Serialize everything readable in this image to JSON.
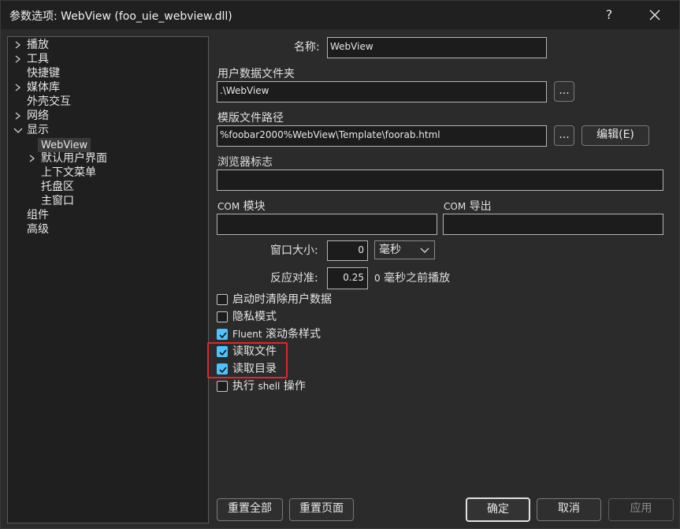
{
  "window": {
    "title": "参数选项: WebView (foo_uie_webview.dll)",
    "help": "?"
  },
  "tree": {
    "items": [
      {
        "label": "播放",
        "chevron": "right"
      },
      {
        "label": "工具",
        "chevron": "right"
      },
      {
        "label": "快捷键"
      },
      {
        "label": "媒体库",
        "chevron": "right"
      },
      {
        "label": "外壳交互"
      },
      {
        "label": "网络",
        "chevron": "right"
      },
      {
        "label": "显示",
        "chevron": "down"
      },
      {
        "label": "WebView",
        "selected": true
      },
      {
        "label": "默认用户界面",
        "chevron": "right"
      },
      {
        "label": "上下文菜单"
      },
      {
        "label": "托盘区"
      },
      {
        "label": "主窗口"
      },
      {
        "label": "组件"
      },
      {
        "label": "高级"
      }
    ]
  },
  "form": {
    "name_label": "名称:",
    "name_value": "WebView",
    "user_data_label": "用户数据文件夹",
    "user_data_value": ".\\WebView",
    "browse1": "...",
    "template_label": "模版文件路径",
    "template_value": "%foobar2000%WebView\\Template\\foorab.html",
    "browse2": "...",
    "edit_button": "编辑(E)",
    "browser_flags_label": "浏览器标志",
    "browser_flags_value": "",
    "com_module_label_prefix": "COM",
    "com_module_label": "模块",
    "com_module_value": "",
    "com_export_label_prefix": "COM",
    "com_export_label": "导出",
    "com_export_value": "",
    "window_size_label": "窗口大小:",
    "window_size_value": "0",
    "window_size_unit": "毫秒",
    "reaction_label": "反应对准:",
    "reaction_value": "0.25",
    "reaction_suffix_num": "0",
    "reaction_suffix": "毫秒之前播放"
  },
  "checkboxes": [
    {
      "label": "启动时清除用户数据",
      "checked": false
    },
    {
      "label": "隐私模式",
      "checked": false
    },
    {
      "label_latin": "Fluent",
      "label": " 滚动条样式",
      "checked": true
    },
    {
      "label": "读取文件",
      "checked": true
    },
    {
      "label": "读取目录",
      "checked": true
    },
    {
      "label": "执行 ",
      "label_latin": "shell",
      "label_tail": " 操作",
      "checked": false
    }
  ],
  "footer": {
    "reset_all": "重置全部",
    "reset_page": "重置页面",
    "ok": "确定",
    "cancel": "取消",
    "apply": "应用"
  },
  "colors": {
    "accent": "#4cc2ff",
    "highlight": "#e0262e"
  }
}
